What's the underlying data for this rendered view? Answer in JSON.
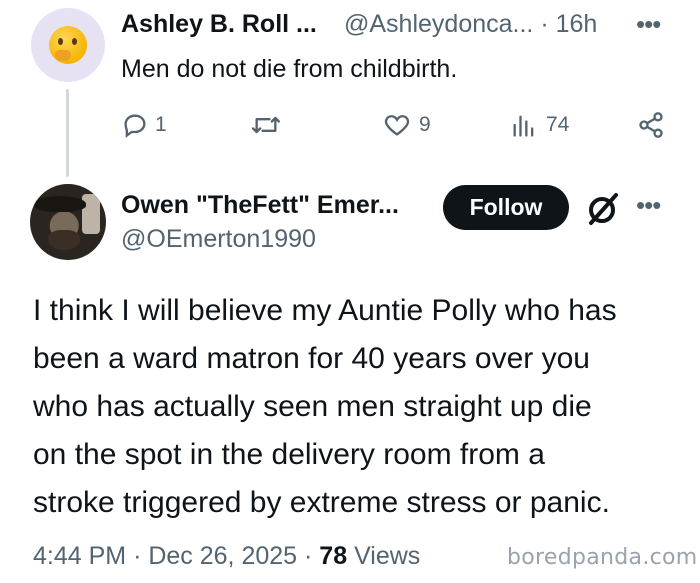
{
  "parent_tweet": {
    "author_name": "Ashley B. Roll ...",
    "author_handle": "@Ashleydonca...",
    "separator": "·",
    "time_ago": "16h",
    "text": "Men do not die from childbirth.",
    "avatar_icon": "thinking-face-emoji",
    "actions": {
      "replies": "1",
      "reposts": "",
      "likes": "9",
      "views": "74"
    }
  },
  "main_tweet": {
    "author_name": "Owen \"TheFett\" Emer...",
    "author_handle": "@OEmerton1990",
    "follow_label": "Follow",
    "text_lines": [
      "I think I will believe my Auntie Polly who has",
      "been a ward matron for 40 years over you",
      "who has actually seen men straight up die",
      "on the spot in the delivery room from a",
      "stroke triggered by extreme stress or panic."
    ],
    "time": "4:44 PM",
    "date": "Dec 26, 2025",
    "views_count": "78",
    "views_label": "Views",
    "separator": "·"
  },
  "watermark": "boredpanda.com",
  "colors": {
    "text_primary": "#0f1419",
    "text_secondary": "#536471",
    "thread_line": "#cfd9de",
    "follow_bg": "#0f1419",
    "avatar_bg": "#e6e2f3"
  }
}
